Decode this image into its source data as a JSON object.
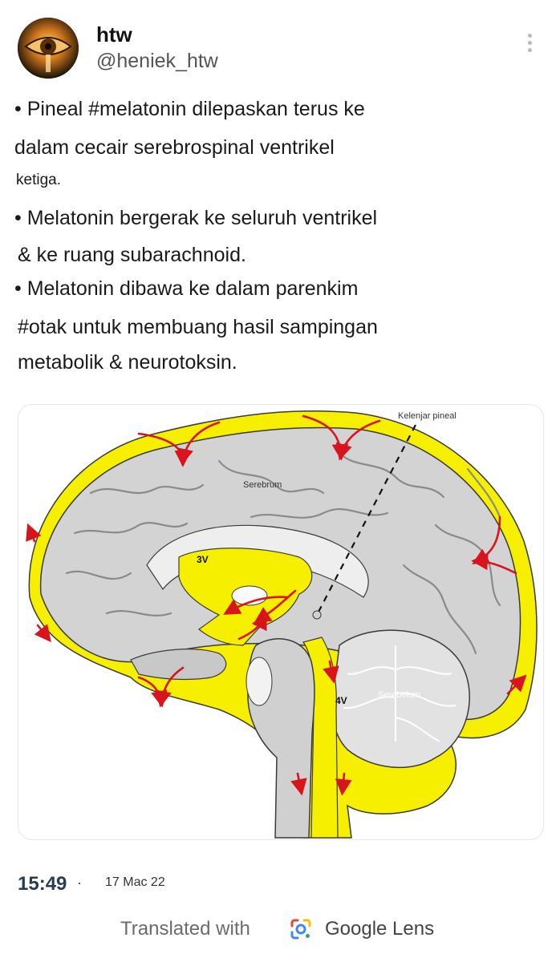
{
  "header": {
    "display_name": "htw",
    "handle": "@heniek_htw",
    "avatar_icon": "eye-avatar-icon",
    "more_icon": "more-vertical-icon"
  },
  "tweet": {
    "lines": [
      "• Pineal #melatonin dilepaskan terus ke",
      "dalam cecair serebrospinal ventrikel",
      "ketiga.",
      "• Melatonin bergerak ke seluruh ventrikel",
      "& ke ruang subarachnoid.",
      "• Melatonin dibawa ke dalam parenkim",
      "#otak untuk membuang hasil sampingan",
      "metabolik & neurotoksin."
    ]
  },
  "figure": {
    "labels": {
      "pineal": "Kelenjar pineal",
      "cerebrum": "Serebrum",
      "third_ventricle": "3V",
      "fourth_ventricle": "4V",
      "cerebellum": "Serebelum"
    },
    "colors": {
      "csf": "#f7ef00",
      "brain": "#d3d3d3",
      "outline": "#333333",
      "arrow": "#d8141c"
    }
  },
  "footer": {
    "time": "15:49",
    "separator": "·",
    "date": "17 Mac 22"
  },
  "lens": {
    "prefix": "Translated with",
    "brand": "Google Lens",
    "icon": "google-lens-icon"
  }
}
